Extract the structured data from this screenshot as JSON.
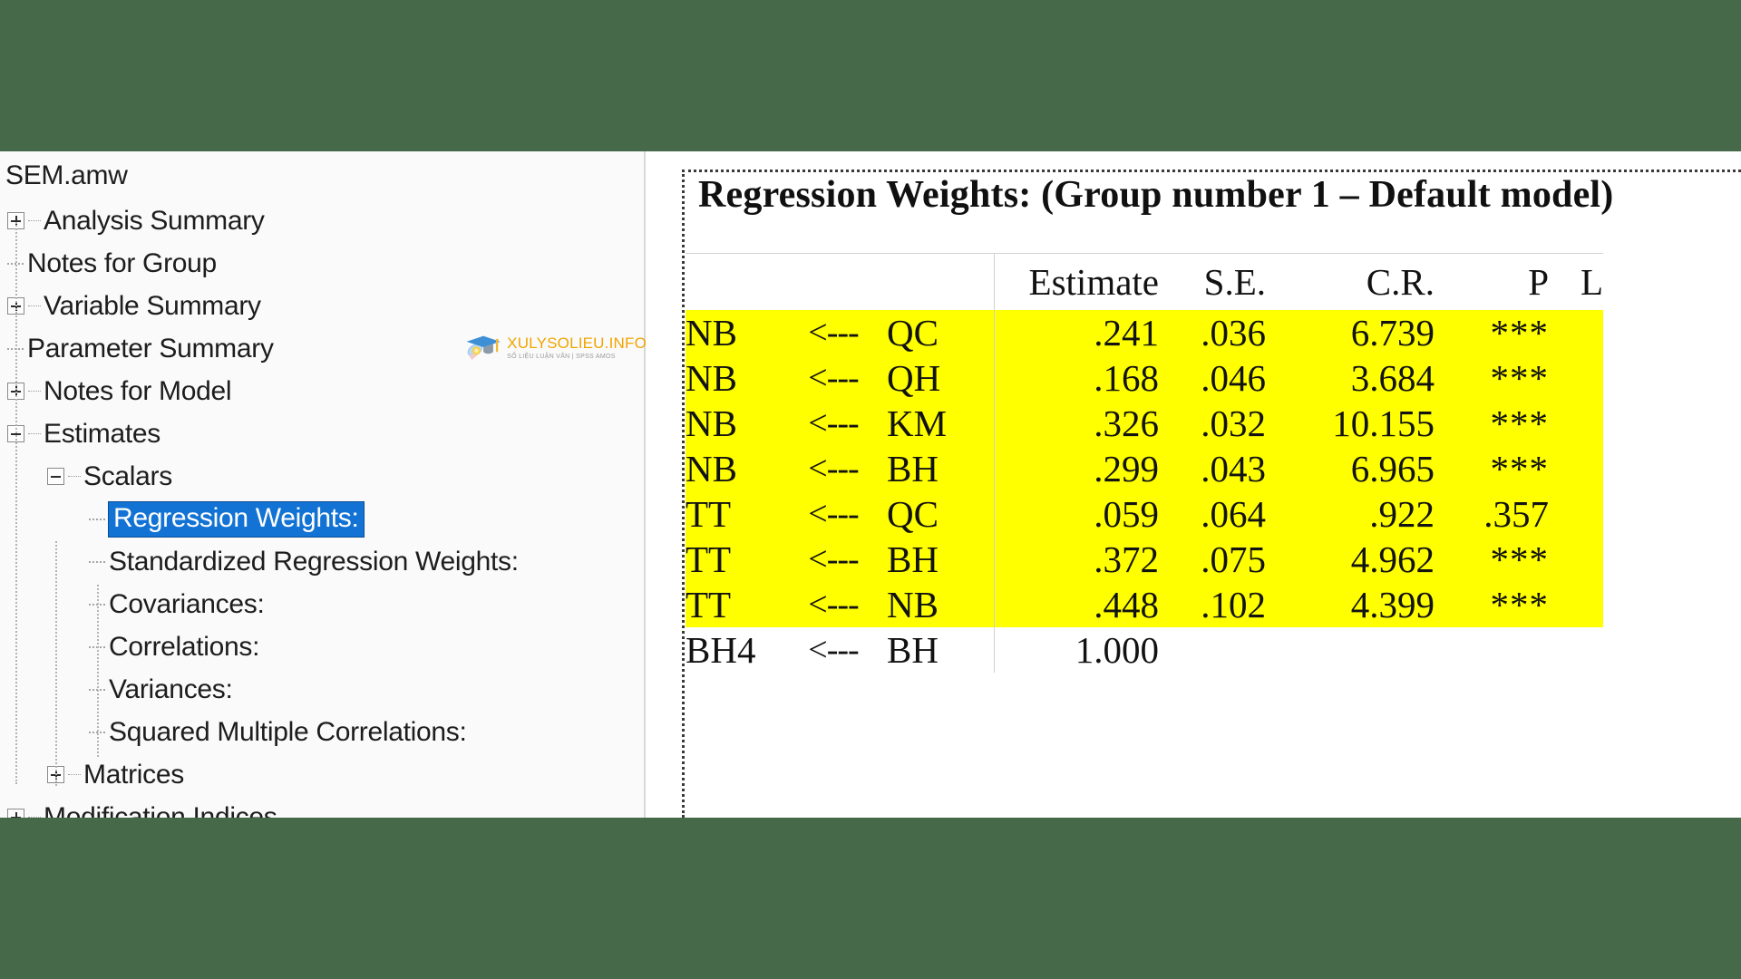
{
  "window": {
    "file_title": "SEM.amw",
    "background_color": "#46694a",
    "highlight_color": "#ffff00",
    "selection_color": "#1273d4"
  },
  "tree": {
    "root_label": "SEM.amw",
    "items": [
      {
        "label": "Analysis Summary",
        "indent": 1,
        "toggle": "plus",
        "selected": false
      },
      {
        "label": "Notes for Group",
        "indent": 1,
        "toggle": "leaf",
        "selected": false
      },
      {
        "label": "Variable Summary",
        "indent": 1,
        "toggle": "plus",
        "selected": false
      },
      {
        "label": "Parameter Summary",
        "indent": 1,
        "toggle": "leaf",
        "selected": false
      },
      {
        "label": "Notes for Model",
        "indent": 1,
        "toggle": "plus",
        "selected": false
      },
      {
        "label": "Estimates",
        "indent": 1,
        "toggle": "minus",
        "selected": false
      },
      {
        "label": "Scalars",
        "indent": 2,
        "toggle": "minus",
        "selected": false
      },
      {
        "label": "Regression Weights:",
        "indent": 3,
        "toggle": "leaf",
        "selected": true
      },
      {
        "label": "Standardized Regression Weights:",
        "indent": 3,
        "toggle": "leaf",
        "selected": false
      },
      {
        "label": "Covariances:",
        "indent": 3,
        "toggle": "leaf",
        "selected": false
      },
      {
        "label": "Correlations:",
        "indent": 3,
        "toggle": "leaf",
        "selected": false
      },
      {
        "label": "Variances:",
        "indent": 3,
        "toggle": "leaf",
        "selected": false
      },
      {
        "label": "Squared Multiple Correlations:",
        "indent": 3,
        "toggle": "leaf",
        "selected": false
      },
      {
        "label": "Matrices",
        "indent": 2,
        "toggle": "plus",
        "selected": false
      },
      {
        "label": "Modification Indices",
        "indent": 1,
        "toggle": "plus",
        "selected": false
      }
    ]
  },
  "output": {
    "title": "Regression Weights: (Group number 1 – Default model)"
  },
  "chart_data": {
    "type": "table",
    "title": "Regression Weights: (Group number 1 – Default model)",
    "columns": [
      "",
      "",
      "",
      "Estimate",
      "S.E.",
      "C.R.",
      "P",
      "L"
    ],
    "headers": {
      "estimate": "Estimate",
      "se": "S.E.",
      "cr": "C.R.",
      "p": "P",
      "label": "L"
    },
    "arrow": "<---",
    "rows": [
      {
        "from": "NB",
        "arrow": "<---",
        "to": "QC",
        "estimate": ".241",
        "se": ".036",
        "cr": "6.739",
        "p": "***",
        "label": "",
        "highlight": true
      },
      {
        "from": "NB",
        "arrow": "<---",
        "to": "QH",
        "estimate": ".168",
        "se": ".046",
        "cr": "3.684",
        "p": "***",
        "label": "",
        "highlight": true
      },
      {
        "from": "NB",
        "arrow": "<---",
        "to": "KM",
        "estimate": ".326",
        "se": ".032",
        "cr": "10.155",
        "p": "***",
        "label": "",
        "highlight": true
      },
      {
        "from": "NB",
        "arrow": "<---",
        "to": "BH",
        "estimate": ".299",
        "se": ".043",
        "cr": "6.965",
        "p": "***",
        "label": "",
        "highlight": true
      },
      {
        "from": "TT",
        "arrow": "<---",
        "to": "QC",
        "estimate": ".059",
        "se": ".064",
        "cr": ".922",
        "p": ".357",
        "label": "",
        "highlight": true
      },
      {
        "from": "TT",
        "arrow": "<---",
        "to": "BH",
        "estimate": ".372",
        "se": ".075",
        "cr": "4.962",
        "p": "***",
        "label": "",
        "highlight": true
      },
      {
        "from": "TT",
        "arrow": "<---",
        "to": "NB",
        "estimate": ".448",
        "se": ".102",
        "cr": "4.399",
        "p": "***",
        "label": "",
        "highlight": true
      },
      {
        "from": "BH4",
        "arrow": "<---",
        "to": "BH",
        "estimate": "1.000",
        "se": "",
        "cr": "",
        "p": "",
        "label": "",
        "highlight": false
      }
    ]
  },
  "watermark": {
    "main": "XULYSOLIEU.INFO",
    "sub": "SỐ LIỆU LUẬN VĂN | SPSS AMOS"
  }
}
